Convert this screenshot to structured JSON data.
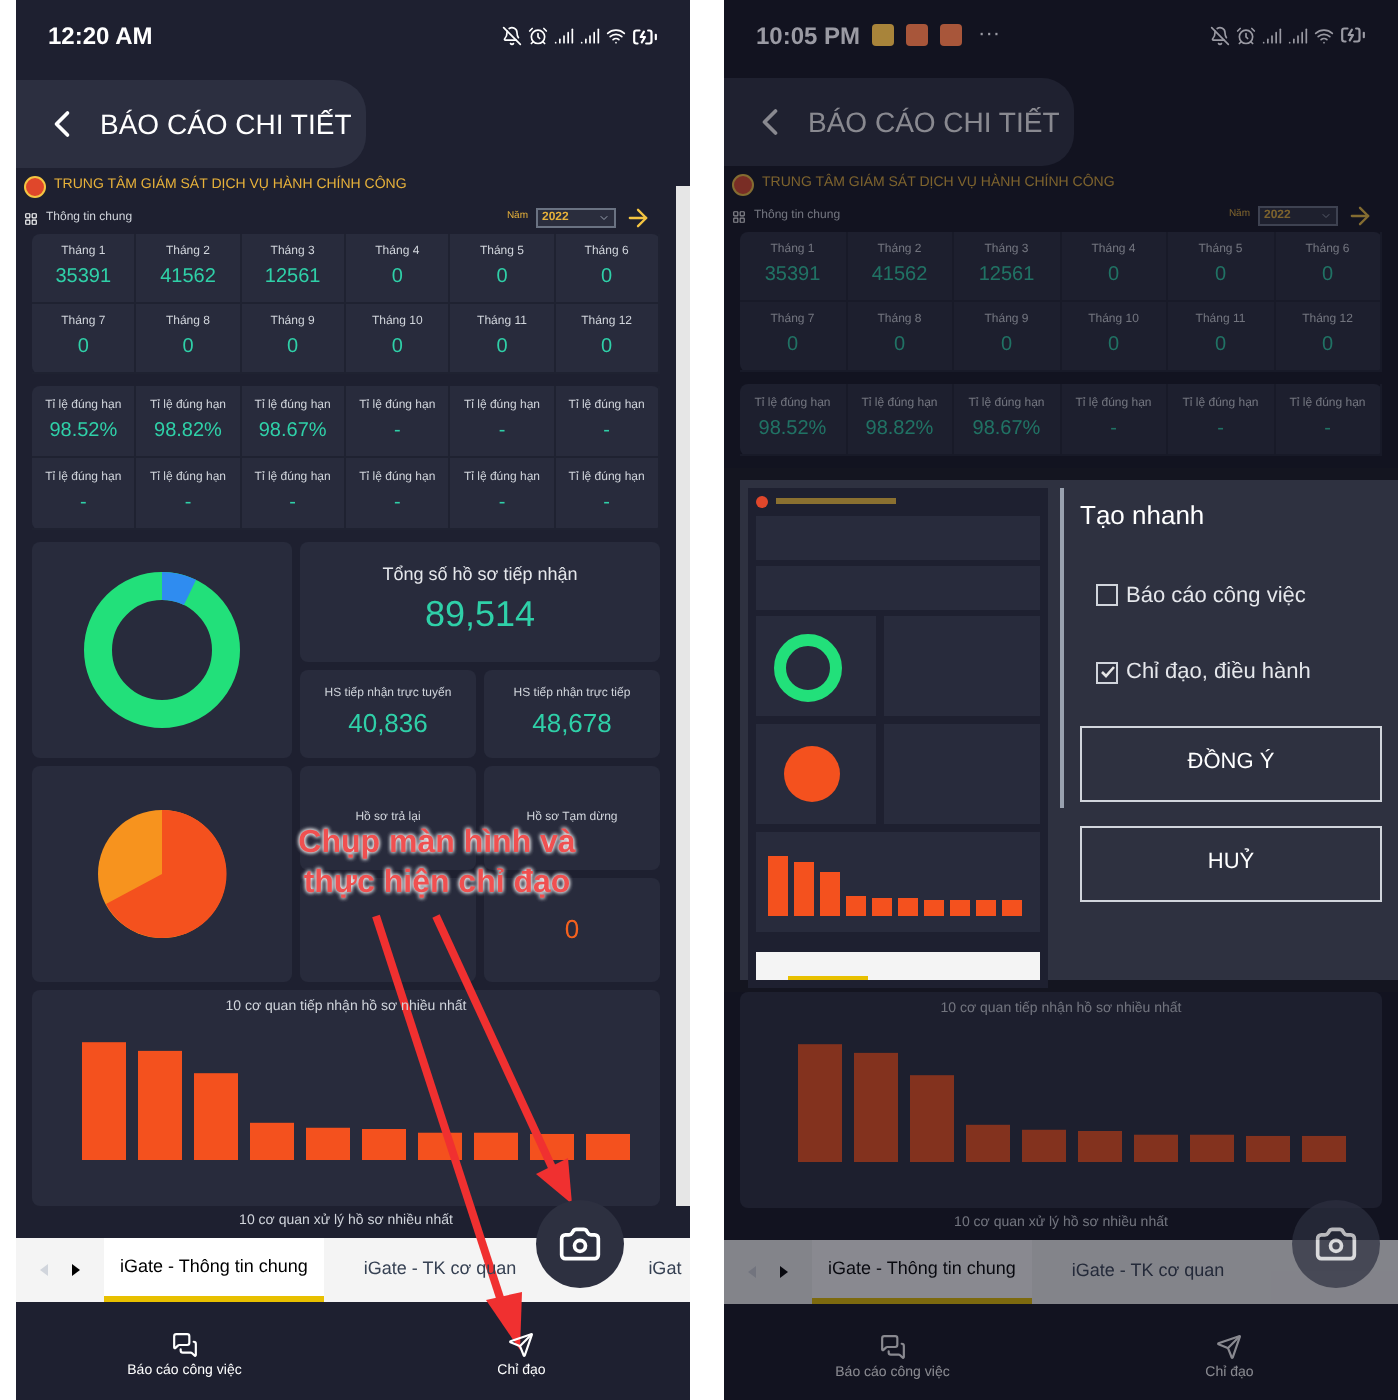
{
  "phones": [
    {
      "status_bar": {
        "time": "12:20 AM"
      },
      "header": {
        "title": "BÁO CÁO CHI TIẾT"
      },
      "dashboard": {
        "org_name": "TRUNG TÂM GIÁM SÁT DỊCH VỤ HÀNH CHÍNH CÔNG",
        "section_label": "Thông tin chung",
        "year_label": "Năm",
        "year": "2022",
        "months": [
          {
            "label": "Tháng 1",
            "value": "35391"
          },
          {
            "label": "Tháng 2",
            "value": "41562"
          },
          {
            "label": "Tháng 3",
            "value": "12561"
          },
          {
            "label": "Tháng 4",
            "value": "0"
          },
          {
            "label": "Tháng 5",
            "value": "0"
          },
          {
            "label": "Tháng 6",
            "value": "0"
          },
          {
            "label": "Tháng 7",
            "value": "0"
          },
          {
            "label": "Tháng 8",
            "value": "0"
          },
          {
            "label": "Tháng 9",
            "value": "0"
          },
          {
            "label": "Tháng 10",
            "value": "0"
          },
          {
            "label": "Tháng 11",
            "value": "0"
          },
          {
            "label": "Tháng 12",
            "value": "0"
          }
        ],
        "rates": [
          {
            "label": "Tỉ lệ đúng hạn",
            "value": "98.52%"
          },
          {
            "label": "Tỉ lệ đúng hạn",
            "value": "98.82%"
          },
          {
            "label": "Tỉ lệ đúng hạn",
            "value": "98.67%"
          },
          {
            "label": "Tỉ lệ đúng hạn",
            "value": "-"
          },
          {
            "label": "Tỉ lệ đúng hạn",
            "value": "-"
          },
          {
            "label": "Tỉ lệ đúng hạn",
            "value": "-"
          },
          {
            "label": "Tỉ lệ đúng hạn",
            "value": "-"
          },
          {
            "label": "Tỉ lệ đúng hạn",
            "value": "-"
          },
          {
            "label": "Tỉ lệ đúng hạn",
            "value": "-"
          },
          {
            "label": "Tỉ lệ đúng hạn",
            "value": "-"
          },
          {
            "label": "Tỉ lệ đúng hạn",
            "value": "-"
          },
          {
            "label": "Tỉ lệ đúng hạn",
            "value": "-"
          }
        ],
        "totals": {
          "title": "Tổng số hồ sơ tiếp nhận",
          "value": "89,514",
          "online": {
            "label": "HS tiếp nhận trực tuyến",
            "value": "40,836"
          },
          "direct": {
            "label": "HS tiếp nhận trực tiếp",
            "value": "48,678"
          }
        },
        "status_cards": [
          {
            "label": "Hồ sơ trả lại"
          },
          {
            "label": "Hồ sơ Tạm dừng"
          },
          {
            "value": "0"
          }
        ],
        "chart_title": "10 cơ quan tiếp nhận hồ sơ nhiều nhất",
        "next_section_title": "10 cơ quan xử lý hồ sơ nhiều nhất"
      },
      "tabs": [
        {
          "label": "iGate - Thông tin chung",
          "selected": true
        },
        {
          "label": "iGate - TK cơ quan",
          "selected": false
        },
        {
          "label": "iGat",
          "selected": false
        }
      ],
      "nav": [
        {
          "kind": "chat",
          "label": "Báo cáo công việc"
        },
        {
          "kind": "send",
          "label": "Chỉ đạo"
        }
      ],
      "annotation": {
        "text": "Chụp màn hình và thực hiện chỉ đạo"
      }
    },
    {
      "status_bar": {
        "time": "10:05 PM",
        "notifications": [
          {
            "color": "#a8843a"
          },
          {
            "color": "#a8563a"
          },
          {
            "color": "#a8563a"
          }
        ],
        "more": "···"
      },
      "header": {
        "title": "BÁO CÁO CHI TIẾT"
      },
      "dashboard": {
        "org_name": "TRUNG TÂM GIÁM SÁT DỊCH VỤ HÀNH CHÍNH CÔNG",
        "section_label": "Thông tin chung",
        "year_label": "Năm",
        "year": "2022",
        "months": [
          {
            "label": "Tháng 1",
            "value": "35391"
          },
          {
            "label": "Tháng 2",
            "value": "41562"
          },
          {
            "label": "Tháng 3",
            "value": "12561"
          },
          {
            "label": "Tháng 4",
            "value": "0"
          },
          {
            "label": "Tháng 5",
            "value": "0"
          },
          {
            "label": "Tháng 6",
            "value": "0"
          },
          {
            "label": "Tháng 7",
            "value": "0"
          },
          {
            "label": "Tháng 8",
            "value": "0"
          },
          {
            "label": "Tháng 9",
            "value": "0"
          },
          {
            "label": "Tháng 10",
            "value": "0"
          },
          {
            "label": "Tháng 11",
            "value": "0"
          },
          {
            "label": "Tháng 12",
            "value": "0"
          }
        ],
        "rates": [
          {
            "label": "Tỉ lệ đúng hạn",
            "value": "98.52%"
          },
          {
            "label": "Tỉ lệ đúng hạn",
            "value": "98.82%"
          },
          {
            "label": "Tỉ lệ đúng hạn",
            "value": "98.67%"
          },
          {
            "label": "Tỉ lệ đúng hạn",
            "value": "-"
          },
          {
            "label": "Tỉ lệ đúng hạn",
            "value": "-"
          },
          {
            "label": "Tỉ lệ đúng hạn",
            "value": "-"
          }
        ],
        "chart_title": "10 cơ quan tiếp nhận hồ sơ nhiều nhất",
        "next_section_title": "10 cơ quan xử lý hồ sơ nhiều nhất"
      },
      "dialog": {
        "title": "Tạo nhanh",
        "options": [
          {
            "label": "Báo cáo công việc",
            "checked": false
          },
          {
            "label": "Chỉ đạo, điều hành",
            "checked": true
          }
        ],
        "buttons": [
          "ĐỒNG Ý",
          "HUỶ"
        ]
      },
      "tabs": [
        {
          "label": "iGate - Thông tin chung",
          "selected": true
        },
        {
          "label": "iGate - TK cơ quan",
          "selected": false
        }
      ],
      "nav": [
        {
          "kind": "chat",
          "label": "Báo cáo công việc"
        },
        {
          "kind": "send",
          "label": "Chỉ đạo"
        }
      ]
    }
  ]
}
